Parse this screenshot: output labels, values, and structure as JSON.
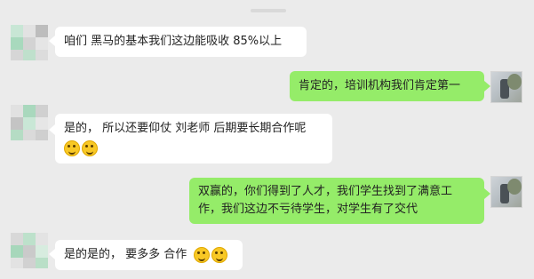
{
  "chat": {
    "messages": [
      {
        "side": "left",
        "text": "咱们 黑马的基本我们这边能吸收 85%以上"
      },
      {
        "side": "right",
        "text": "肯定的，培训机构我们肯定第一"
      },
      {
        "side": "left",
        "text": "是的， 所以还要仰仗 刘老师 后期要长期合作呢",
        "emoji": [
          "smile-emoji",
          "smile-emoji"
        ]
      },
      {
        "side": "right",
        "line1": "双赢的，你们得到了人才，我们学生找到了满意工",
        "line2": "作，我们这边不亏待学生，对学生有了交代"
      },
      {
        "side": "left",
        "text": "是的是的， 要多多 合作",
        "emoji": [
          "smile-emoji",
          "smile-emoji"
        ]
      }
    ]
  },
  "colors": {
    "background": "#ebebeb",
    "left_bubble": "#ffffff",
    "right_bubble": "#95ec69"
  }
}
